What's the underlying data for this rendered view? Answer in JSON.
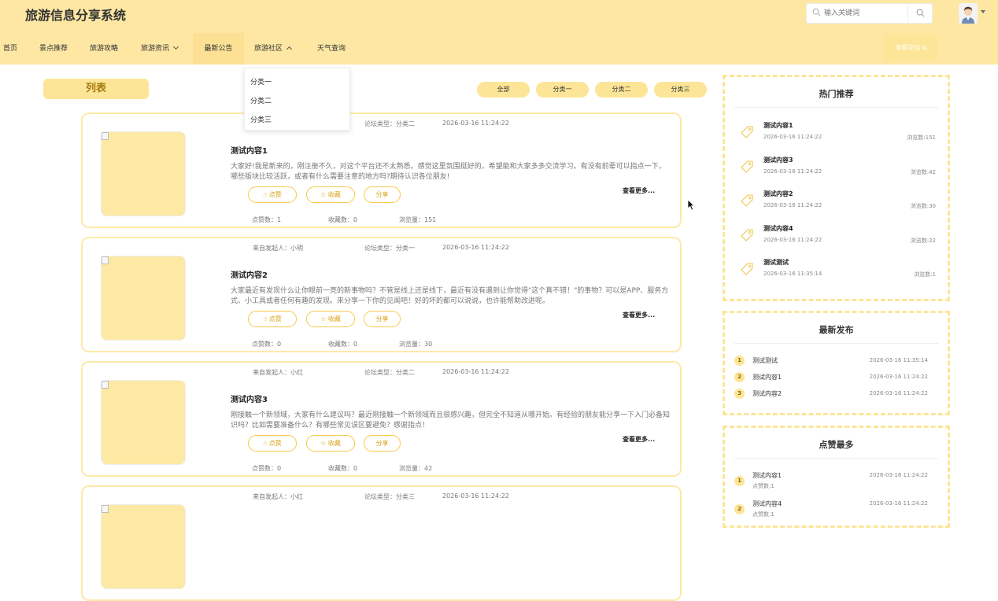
{
  "header": {
    "site_title": "旅游信息分享系统",
    "search_placeholder": "输入关键词"
  },
  "nav": {
    "items": [
      {
        "label": "首页"
      },
      {
        "label": "景点推荐"
      },
      {
        "label": "旅游攻略"
      },
      {
        "label": "旅游资讯"
      },
      {
        "label": "最新公告"
      },
      {
        "label": "旅游社区"
      },
      {
        "label": "天气查询"
      }
    ],
    "forum_button": "查看论坛"
  },
  "dropdown": {
    "items": [
      "分类一",
      "分类二",
      "分类三"
    ]
  },
  "list": {
    "title": "列表",
    "filters": [
      "全部",
      "分类一",
      "分类二",
      "分类三"
    ]
  },
  "posts": [
    {
      "author": "",
      "category": "论坛类型：分类二",
      "time": "2026-03-16 11:24:22",
      "title": "测试内容1",
      "desc": "大家好!我是新来的，刚注册不久，对这个平台还不太熟悉。感觉这里氛围挺好的，希望能和大家多多交流学习。有没有前辈可以指点一下，哪些版块比较活跃，或者有什么需要注意的地方吗?期待认识各位朋友!",
      "like": "点赞",
      "fav": "收藏",
      "share": "分享",
      "more": "查看更多...",
      "likes": "点赞数：1",
      "favs": "收藏数：0",
      "views": "浏览量：151"
    },
    {
      "author": "来自发起人：小明",
      "category": "论坛类型：分类一",
      "time": "2026-03-16 11:24:22",
      "title": "测试内容2",
      "desc": "大家最近有发现什么让你眼前一亮的新事物吗？不管是线上还是线下，最近有没有遇到让你觉得\"这个真不错！\"的事物？可以是APP、服务方式、小工具或者任何有趣的发现。来分享一下你的见闻吧！好的坏的都可以说说，也许能帮助改进呢。",
      "like": "点赞",
      "fav": "收藏",
      "share": "分享",
      "more": "查看更多...",
      "likes": "点赞数：0",
      "favs": "收藏数：0",
      "views": "浏览量：30"
    },
    {
      "author": "来自发起人：小红",
      "category": "论坛类型：分类二",
      "time": "2026-03-16 11:24:22",
      "title": "测试内容3",
      "desc": "刚接触一个新领域，大家有什么建议吗？最近刚接触一个新领域而且很感兴趣，但完全不知道从哪开始。有经验的朋友能分享一下入门必备知识吗？比如需要准备什么？有哪些常见误区要避免？感谢指点！",
      "like": "点赞",
      "fav": "收藏",
      "share": "分享",
      "more": "查看更多...",
      "likes": "点赞数：0",
      "favs": "收藏数：0",
      "views": "浏览量：42"
    },
    {
      "author": "来自发起人：小红",
      "category": "论坛类型：分类三",
      "time": "2026-03-16 11:24:22",
      "title": "",
      "desc": "",
      "like": "",
      "fav": "",
      "share": "",
      "more": "",
      "likes": "",
      "favs": "",
      "views": ""
    }
  ],
  "hot": {
    "title": "热门推荐",
    "items": [
      {
        "name": "测试内容1",
        "date": "2026-03-16 11:24:22",
        "views": "浏览数:151"
      },
      {
        "name": "测试内容3",
        "date": "2026-03-16 11:24:22",
        "views": "浏览数:42"
      },
      {
        "name": "测试内容2",
        "date": "2026-03-16 11:24:22",
        "views": "浏览数:30"
      },
      {
        "name": "测试内容4",
        "date": "2026-03-16 11:24:22",
        "views": "浏览数:22"
      },
      {
        "name": "测试测试",
        "date": "2026-03-16 11:35:14",
        "views": "浏览数:1"
      }
    ]
  },
  "latest": {
    "title": "最新发布",
    "items": [
      {
        "num": "1",
        "name": "测试测试",
        "date": "2026-03-16 11:35:14"
      },
      {
        "num": "2",
        "name": "测试内容1",
        "date": "2026-03-16 11:24:22"
      },
      {
        "num": "3",
        "name": "测试内容2",
        "date": "2026-03-16 11:24:22"
      }
    ]
  },
  "mostliked": {
    "title": "点赞最多",
    "items": [
      {
        "num": "1",
        "name": "测试内容1",
        "date": "2026-03-16 11:24:22",
        "likes": "点赞数:1"
      },
      {
        "num": "2",
        "name": "测试内容4",
        "date": "2026-03-16 11:24:22",
        "likes": "点赞数:1"
      }
    ]
  },
  "colors": {
    "header_bg": "#fde7a3",
    "accent": "#fde597",
    "button_text": "#d8a113"
  }
}
